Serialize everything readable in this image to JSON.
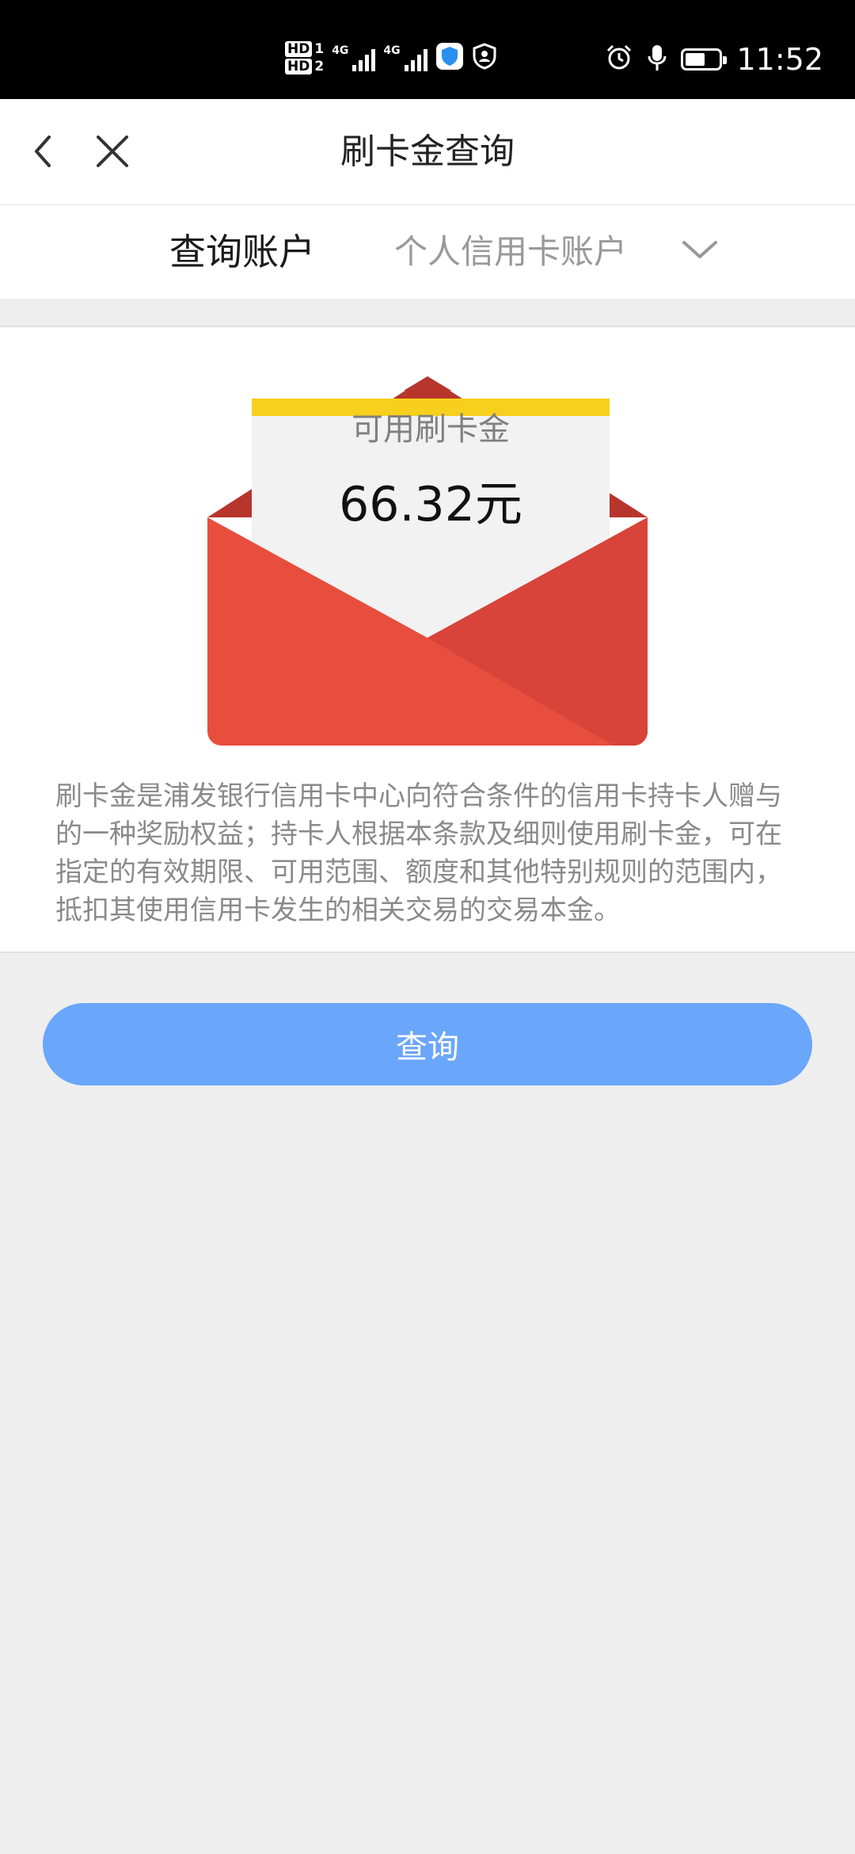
{
  "status_bar": {
    "time": "11:52",
    "sim1_label": "HD",
    "sim1_index": "1",
    "sim2_label": "HD",
    "sim2_index": "2",
    "network1": "4G",
    "network2": "4G",
    "battery_level": 0.6,
    "icons": [
      "shield-icon",
      "profile-icon",
      "alarm-icon",
      "microphone-icon",
      "battery-icon"
    ]
  },
  "nav": {
    "title": "刷卡金查询",
    "back_icon": "chevron-left-icon",
    "close_icon": "close-icon"
  },
  "account": {
    "label": "查询账户",
    "selected": "个人信用卡账户",
    "dropdown_icon": "chevron-down-icon"
  },
  "card": {
    "letter_label": "可用刷卡金",
    "amount": "66.32元",
    "description": "刷卡金是浦发银行信用卡中心向符合条件的信用卡持卡人赠与的一种奖励权益；持卡人根据本条款及细则使用刷卡金，可在指定的有效期限、可用范围、额度和其他特别规则的范围内，抵扣其使用信用卡发生的相关交易的交易本金。"
  },
  "actions": {
    "query_label": "查询"
  },
  "colors": {
    "accent_button": "#6aa6fa",
    "envelope_red": "#e84e3e",
    "envelope_dark": "#c9392f",
    "letter_stripe": "#f7cf1d"
  }
}
